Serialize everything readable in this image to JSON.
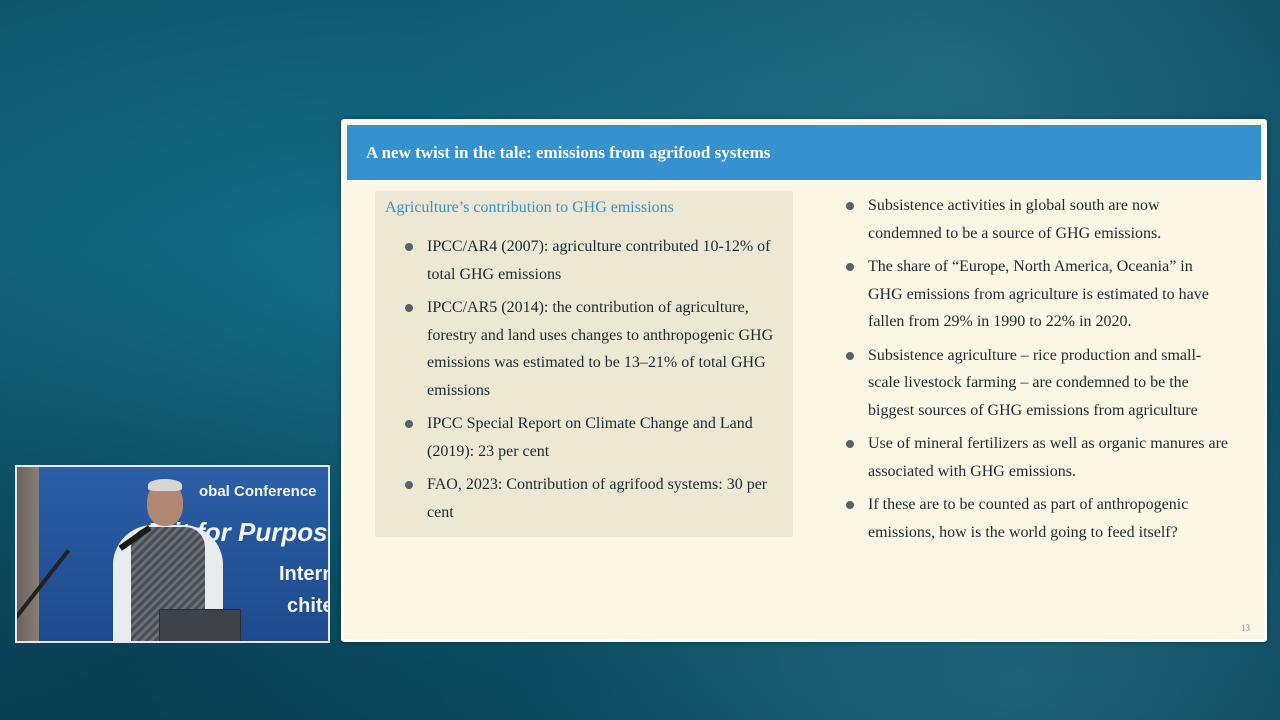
{
  "slide": {
    "title": "A new twist in the tale: emissions from agrifood systems",
    "page_number": "13",
    "left_panel": {
      "heading": "Agriculture’s contribution to GHG emissions",
      "items": [
        "IPCC/AR4 (2007): agriculture contributed 10-12% of total GHG emissions",
        "IPCC/AR5 (2014): the contribution of agriculture, forestry and land uses changes to anthropogenic GHG emissions was estimated to be 13–21% of total GHG emissions",
        "IPCC Special Report on Climate Change and Land (2019): 23 per cent",
        "FAO, 2023: Contribution of agrifood systems: 30 per cent"
      ]
    },
    "right_panel": {
      "items": [
        "Subsistence activities in global south are now condemned to be a source of GHG emissions.",
        "The share of “Europe, North America, Oceania” in GHG emissions from agriculture is estimated to have fallen from 29% in 1990 to 22% in 2020.",
        "Subsistence agriculture – rice production and small-scale livestock farming – are condemned to be the biggest sources of GHG emissions from agriculture",
        "Use of mineral fertilizers as well as organic manures are associated with GHG emissions.",
        "If these are to be counted as part of anthropogenic emissions, how is the world going to feed itself?"
      ]
    }
  },
  "speaker_video": {
    "banner_lines": [
      "obal Conference",
      "R    it for Purpos",
      "Internat",
      "chitectur"
    ]
  },
  "colors": {
    "header_blue": "#3592ce",
    "slide_bg": "#fbf7e4",
    "panel_bg": "#ece8d3",
    "background_teal": "#0f5b73"
  }
}
